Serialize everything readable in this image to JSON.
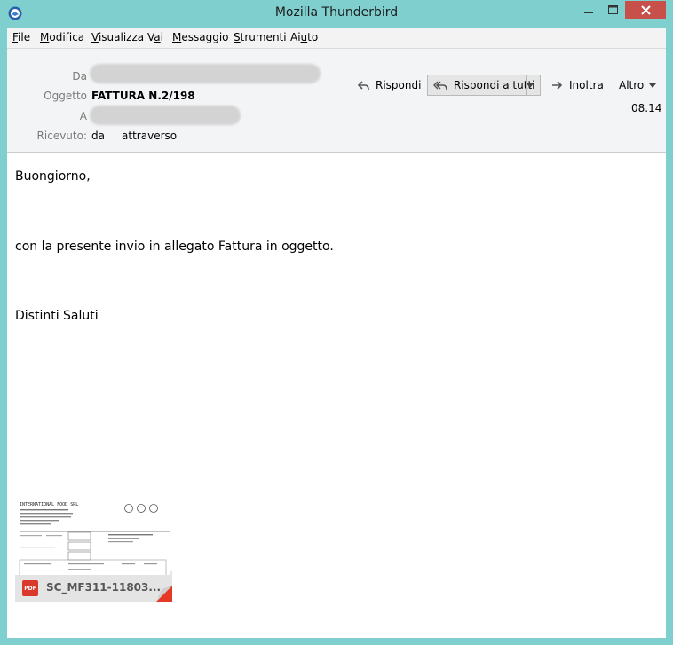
{
  "window": {
    "title": "Mozilla Thunderbird"
  },
  "menu": {
    "file": {
      "pre": "",
      "key": "F",
      "post": "ile"
    },
    "edit": {
      "pre": "",
      "key": "M",
      "post": "odifica"
    },
    "view": {
      "pre": "",
      "key": "V",
      "post": "isualizza"
    },
    "go": {
      "pre": "V",
      "key": "a",
      "post": "i"
    },
    "message": {
      "pre": "",
      "key": "M",
      "post": "essaggio"
    },
    "tools": {
      "pre": "",
      "key": "S",
      "post": "trumenti"
    },
    "help": {
      "pre": "Ai",
      "key": "u",
      "post": "to"
    }
  },
  "header": {
    "from_label": "Da",
    "subject_label": "Oggetto",
    "subject": "FATTURA N.2/198",
    "to_label": "A",
    "received_label": "Ricevuto:",
    "received_value": "da     attraverso",
    "time": "08.14"
  },
  "toolbar": {
    "reply": "Rispondi",
    "reply_all": "Rispondi a tutti",
    "forward": "Inoltra",
    "more": "Altro"
  },
  "body": {
    "greeting": "Buongiorno,",
    "line1": "con la presente invio in allegato Fattura in oggetto.",
    "closing": "Distinti Saluti"
  },
  "attachment": {
    "name": "SC_MF311-11803...",
    "type_badge": "PDF",
    "thumb_heading": "INTERNATIONAL FOOD SRL"
  },
  "colors": {
    "window_frame": "#7fcfcf",
    "close_button": "#c7504a",
    "pdf_red": "#d9382b"
  }
}
